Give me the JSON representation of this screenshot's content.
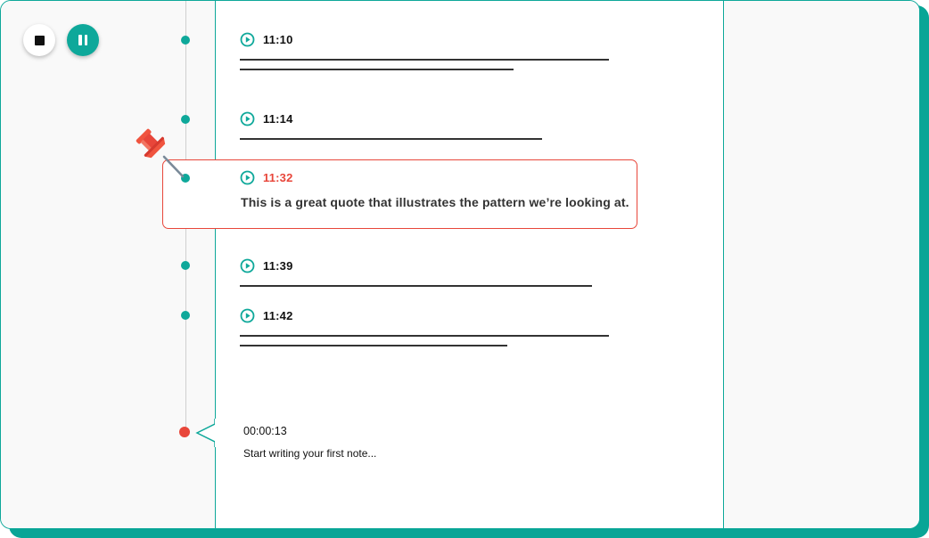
{
  "controls": {
    "stop": "stop-icon",
    "pause": "pause-icon"
  },
  "entries": [
    {
      "time": "11:10"
    },
    {
      "time": "11:14"
    },
    {
      "time": "11:32",
      "pinned": true,
      "quote": "This is a great quote that illustrates the pattern we’re looking at."
    },
    {
      "time": "11:39"
    },
    {
      "time": "11:42"
    }
  ],
  "recording": {
    "elapsed": "00:00:13",
    "note_placeholder": "Start writing your first note..."
  },
  "colors": {
    "accent": "#0ea89a",
    "pin": "#e8463a",
    "text": "#111111"
  }
}
